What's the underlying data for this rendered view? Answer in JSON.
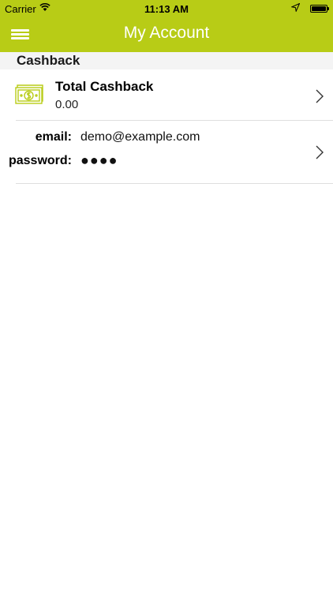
{
  "status_bar": {
    "carrier": "Carrier",
    "time": "11:13 AM"
  },
  "nav": {
    "title": "My Account",
    "menu_icon": "hamburger-menu-icon"
  },
  "section": {
    "title": "Cashback"
  },
  "cashback": {
    "title": "Total Cashback",
    "value": "0.00",
    "icon": "cash-bill-icon"
  },
  "account": {
    "email_label": "email:",
    "email_value": "demo@example.com",
    "password_label": "password:",
    "password_value": "●●●●"
  },
  "colors": {
    "accent": "#b8cc16",
    "background": "#ffffff",
    "section_bg": "#f4f4f4",
    "separator": "#dedede"
  }
}
